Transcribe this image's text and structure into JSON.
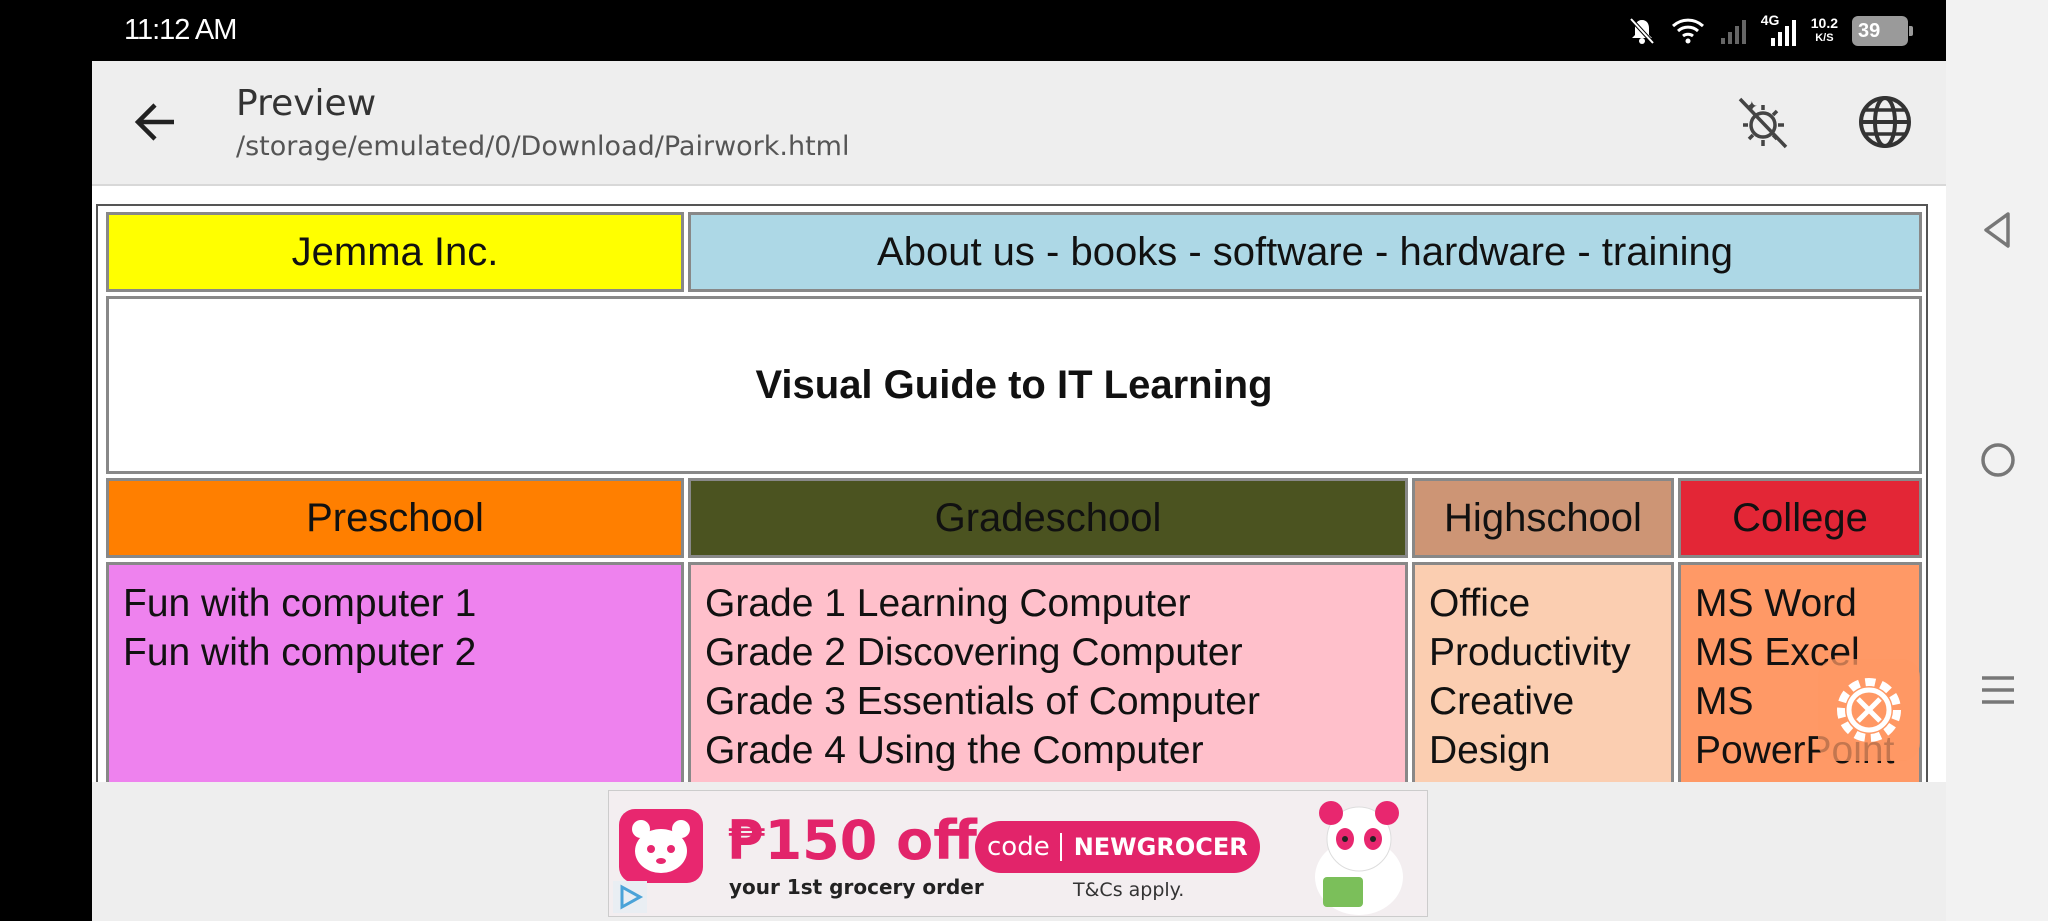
{
  "status_bar": {
    "time": "11:12 AM",
    "network": "4G",
    "speed_value": "10.2",
    "speed_unit": "K/S",
    "battery": "39"
  },
  "toolbar": {
    "title": "Preview",
    "path": "/storage/emulated/0/Download/Pairwork.html",
    "icons": [
      "back-arrow-icon",
      "night-mode-icon",
      "globe-icon"
    ]
  },
  "page": {
    "company": "Jemma Inc.",
    "nav_links": "About us - books - software - hardware - training",
    "heading": "Visual Guide to IT Learning",
    "columns": [
      {
        "header": "Preschool",
        "header_color": "#ff7f00",
        "body_color": "#ee82ee",
        "items": [
          "Fun with computer 1",
          "Fun with computer 2"
        ]
      },
      {
        "header": "Gradeschool",
        "header_color": "#4b5320",
        "body_color": "#ffc0cb",
        "items": [
          "Grade 1 Learning Computer",
          "Grade 2 Discovering Computer",
          "Grade 3 Essentials of Computer",
          "Grade 4 Using the Computer"
        ]
      },
      {
        "header": "Highschool",
        "header_color": "#cd9575",
        "body_color": "#fbceb1",
        "items": [
          "Office",
          "Productivity",
          "Creative",
          "Design"
        ]
      },
      {
        "header": "College",
        "header_color": "#e32636",
        "body_color": "#ff9966",
        "items": [
          "MS Word",
          "MS Excel",
          "MS",
          "PowerPoint"
        ]
      }
    ],
    "company_color": "#ffff00",
    "nav_color": "#add8e6"
  },
  "ad": {
    "headline": "₱150 off",
    "subline": "your 1st grocery order",
    "code_label": "code",
    "code": "NEWGROCER",
    "terms": "T&Cs apply."
  },
  "system_nav": [
    "back-triangle-icon",
    "home-circle-icon",
    "menu-lines-icon"
  ]
}
